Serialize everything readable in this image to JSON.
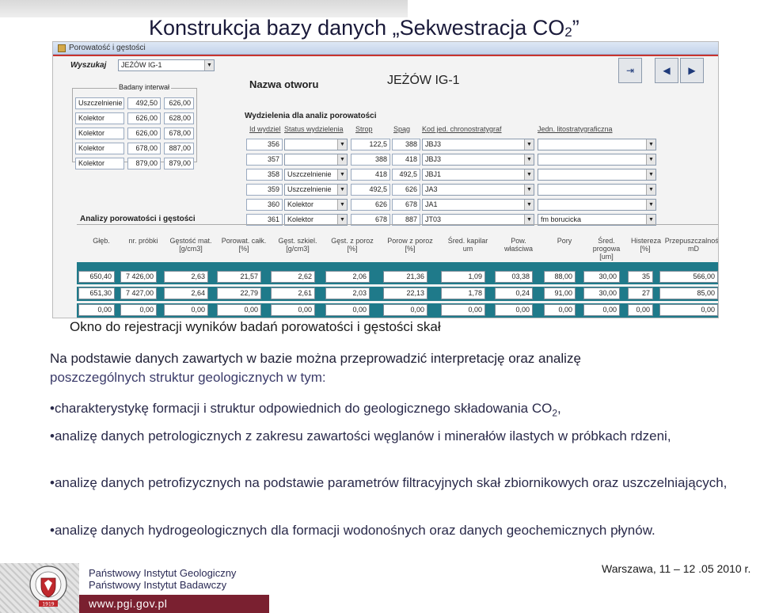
{
  "slide": {
    "title_main": "Konstrukcja bazy danych „Sekwestracja CO",
    "title_sub": "2",
    "title_end": "”"
  },
  "app": {
    "window_title": "Porowatość i gęstości",
    "search_label": "Wyszukaj",
    "search_value": "JEŻÓW IG-1",
    "interval_label": "Badany interwał",
    "hole_name_label": "Nazwa otworu",
    "hole_name_value": "JEŻÓW IG-1",
    "intervals": [
      {
        "status": "Uszczelnienie",
        "from": "492,50",
        "to": "626,00"
      },
      {
        "status": "Kolektor",
        "from": "626,00",
        "to": "628,00"
      },
      {
        "status": "Kolektor",
        "from": "626,00",
        "to": "678,00"
      },
      {
        "status": "Kolektor",
        "from": "678,00",
        "to": "887,00"
      },
      {
        "status": "Kolektor",
        "from": "879,00",
        "to": "879,00"
      }
    ],
    "sections_label": "Wydzielenia dla analiz porowatości",
    "sections_headers": [
      "Id wydziel",
      "Status wydzielenia",
      "Strop",
      "Spąg",
      "Kod jed. chronostratygraf",
      "Jedn. litostratygraficzna"
    ],
    "sections_rows": [
      {
        "id": "356",
        "status": "",
        "top": "122,5",
        "bottom": "388",
        "code": "JBJ3",
        "lith": ""
      },
      {
        "id": "357",
        "status": "",
        "top": "388",
        "bottom": "418",
        "code": "JBJ3",
        "lith": ""
      },
      {
        "id": "358",
        "status": "Uszczelnienie",
        "top": "418",
        "bottom": "492,5",
        "code": "JBJ1",
        "lith": ""
      },
      {
        "id": "359",
        "status": "Uszczelnienie",
        "top": "492,5",
        "bottom": "626",
        "code": "JA3",
        "lith": ""
      },
      {
        "id": "360",
        "status": "Kolektor",
        "top": "626",
        "bottom": "678",
        "code": "JA1",
        "lith": ""
      },
      {
        "id": "361",
        "status": "Kolektor",
        "top": "678",
        "bottom": "887",
        "code": "JT03",
        "lith": "fm borucicka"
      }
    ],
    "analysis_label": "Analizy porowatości i gęstości",
    "analysis_headers": [
      "Głęb.",
      "nr. próbki",
      "Gęstość mat. [g/cm3]",
      "Porowat. całk. [%]",
      "Gęst. szkiel. [g/cm3]",
      "Gęst. z poroz [%]",
      "Porow z poroz [%]",
      "Śred. kapilar um",
      "Pow. właściwa",
      "Pory",
      "Śred. progowa [um]",
      "Histereza [%]",
      "Przepuszczalność mD"
    ],
    "analysis_rows": [
      [
        "650,40",
        "7 426,00",
        "2,63",
        "21,57",
        "2,62",
        "2,06",
        "21,36",
        "1,09",
        "03,38",
        "88,00",
        "30,00",
        "35",
        "566,00"
      ],
      [
        "651,30",
        "7 427,00",
        "2,64",
        "22,79",
        "2,61",
        "2,03",
        "22,13",
        "1,78",
        "0,24",
        "91,00",
        "30,00",
        "27",
        "85,00"
      ],
      [
        "0,00",
        "0,00",
        "0,00",
        "0,00",
        "0,00",
        "0,00",
        "0,00",
        "0,00",
        "0,00",
        "0,00",
        "0,00",
        "0,00",
        "0,00"
      ]
    ]
  },
  "caption": "Okno do rejestracji wyników badań porowatości i gęstości skał",
  "intro_a": "Na podstawie danych zawartych w bazie można przeprowadzić interpretację oraz analizę",
  "intro_b": "poszczególnych struktur geologicznych w tym:",
  "bullets": {
    "b1_pre": "•charakterystykę formacji i struktur odpowiednich do geologicznego składowania CO",
    "b1_sub": "2",
    "b1_post": ",",
    "b2": "•analizę danych petrologicznych z zakresu zawartości węglanów i minerałów ilastych w próbkach rdzeni,",
    "b3": "•analizę danych petrofizycznych na podstawie parametrów filtracyjnych skał zbiornikowych oraz uszczelniających,",
    "b4": "•analizę danych hydrogeologicznych dla formacji wodonośnych oraz danych geochemicznych płynów."
  },
  "footer": {
    "institute_line1": "Państwowy Instytut Geologiczny",
    "institute_line2": "Państwowy Instytut Badawczy",
    "website": "www.pgi.gov.pl",
    "date": "Warszawa, 11 – 12 .05  2010 r.",
    "seal_year": "1919",
    "accent_color": "#7a2030"
  }
}
